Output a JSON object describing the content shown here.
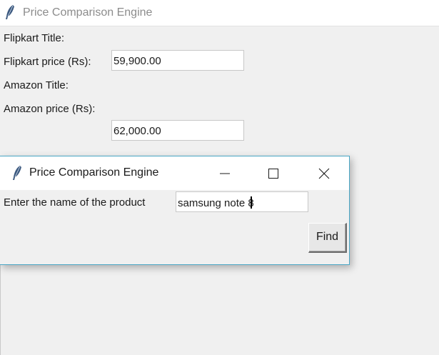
{
  "main_window": {
    "title": "Price Comparison Engine",
    "flipkart_title_label": "Flipkart Title:",
    "flipkart_price_label": "Flipkart price (Rs):",
    "flipkart_price_value": "59,900.00",
    "amazon_title_label": "Amazon Title:",
    "amazon_price_label": "Amazon price (Rs):",
    "amazon_price_value": "62,000.00"
  },
  "dialog": {
    "title": "Price Comparison Engine",
    "product_label": "Enter the name of the product",
    "product_value": "samsung note 8",
    "find_label": "Find"
  },
  "icons": {
    "app": "feather-icon",
    "minimize": "minimize-icon",
    "maximize": "maximize-icon",
    "close": "close-icon"
  },
  "colors": {
    "dialog_border": "#4aa7c6",
    "background": "#f0f0f0"
  }
}
